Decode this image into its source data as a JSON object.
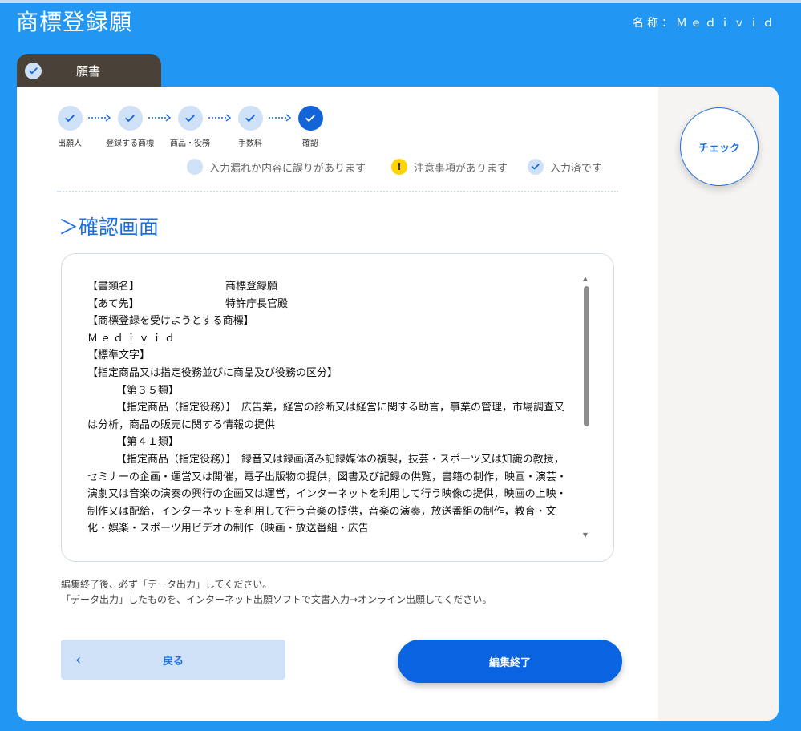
{
  "header": {
    "title": "商標登録願",
    "name_label": "名称：Ｍｅｄｉｖｉｄ"
  },
  "tab": {
    "label": "願書"
  },
  "steps": [
    {
      "label": "出願人"
    },
    {
      "label": "登録する商標"
    },
    {
      "label": "商品・役務"
    },
    {
      "label": "手数料"
    },
    {
      "label": "確認"
    }
  ],
  "legend": {
    "error": "入力漏れか内容に誤りがあります",
    "warning": "注意事項があります",
    "warning_symbol": "!",
    "done": "入力済です"
  },
  "section_title": "＞確認画面",
  "document": {
    "lines": [
      {
        "key": "【書類名】",
        "value": "商標登録願"
      },
      {
        "key": "【あて先】",
        "value": "特許庁長官殿"
      },
      {
        "text": "【商標登録を受けようとする商標】"
      },
      {
        "text": "Ｍｅｄｉｖｉｄ"
      },
      {
        "text": "【標準文字】"
      },
      {
        "text": "【指定商品又は指定役務並びに商品及び役務の区分】"
      },
      {
        "text": "【第３５類】"
      },
      {
        "text": "【指定商品（指定役務）】　広告業，経営の診断又は経営に関する助言，事業の管理，市場調査又は分析，商品の販売に関する情報の提供"
      },
      {
        "text": "【第４１類】"
      },
      {
        "text": "【指定商品（指定役務）】　録音又は録画済み記録媒体の複製，技芸・スポーツ又は知識の教授，セミナーの企画・運営又は開催，電子出版物の提供，図書及び記録の供覧，書籍の制作，映画・演芸・演劇又は音楽の演奏の興行の企画又は運営，インターネットを利用して行う映像の提供，映画の上映・制作又は配給，インターネットを利用して行う音楽の提供，音楽の演奏，放送番組の制作，教育・文化・娯楽・スポーツ用ビデオの制作（映画・放送番組・広告"
      }
    ]
  },
  "notes": {
    "line1": "編集終了後、必ず「データ出力」してください。",
    "line2": "「データ出力」したものを、インターネット出願ソフトで文書入力→オンライン出願してください。"
  },
  "buttons": {
    "check": "チェック",
    "back": "戻る",
    "back_chevron": "‹",
    "finish": "編集終了"
  },
  "colors": {
    "primary": "#2196F3",
    "accent": "#0a63e0",
    "step_done": "#cfe1f7",
    "warning": "#ffd400"
  }
}
